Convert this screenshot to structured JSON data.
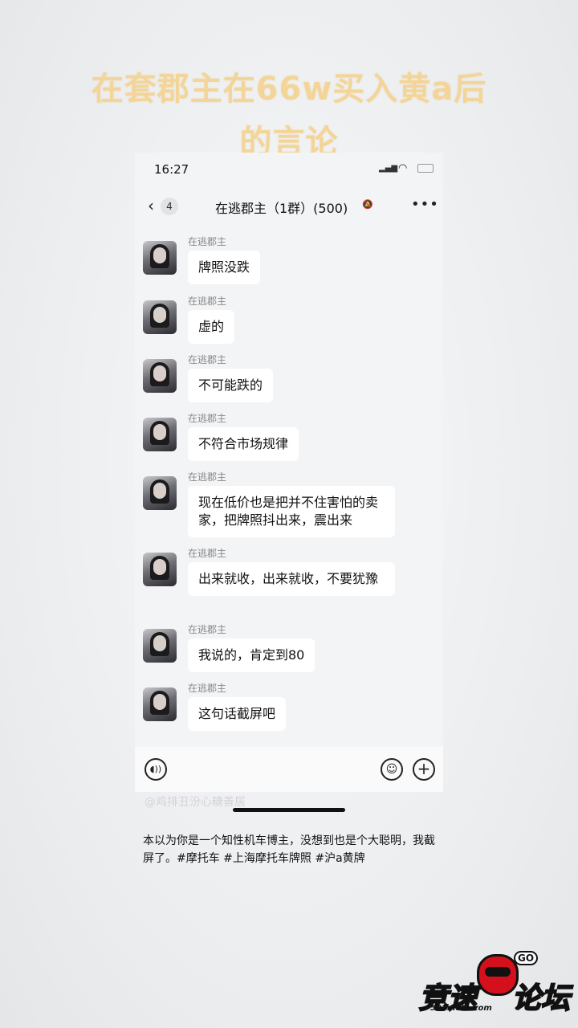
{
  "headline": {
    "line1": "在套郡主在66w买入黄a后",
    "line2": "的言论"
  },
  "status_bar": {
    "time": "16:27"
  },
  "chat_header": {
    "unread_count": "4",
    "title": "在逃郡主（1群）(500)"
  },
  "messages": [
    {
      "sender": "在逃郡主",
      "text": "牌照没跌"
    },
    {
      "sender": "在逃郡主",
      "text": "虚的"
    },
    {
      "sender": "在逃郡主",
      "text": "不可能跌的"
    },
    {
      "sender": "在逃郡主",
      "text": "不符合市场规律"
    },
    {
      "sender": "在逃郡主",
      "text": "现在低价也是把并不住害怕的卖家，把牌照抖出来，震出来"
    },
    {
      "sender": "在逃郡主",
      "text": "出来就收，出来就收，不要犹豫"
    },
    {
      "sender": "在逃郡主",
      "text": "我说的，肯定到80"
    },
    {
      "sender": "在逃郡主",
      "text": "这句话截屏吧"
    }
  ],
  "watermark": "@鸡排丑汾心糖善居",
  "caption": "本以为你是一个知性机车博主，没想到也是个大聪明，我截屏了。#摩托车 #上海摩托车牌照 #沪a黄牌",
  "logo": {
    "part1": "竞速",
    "part2": "论坛",
    "url": "591moto.com",
    "bubble": "GO"
  },
  "icons": {
    "back": "chevron-left-icon",
    "mute": "mute-bell-icon",
    "more": "more-dots-icon",
    "voice": "voice-icon",
    "emoji": "emoji-icon",
    "plus": "plus-icon"
  }
}
